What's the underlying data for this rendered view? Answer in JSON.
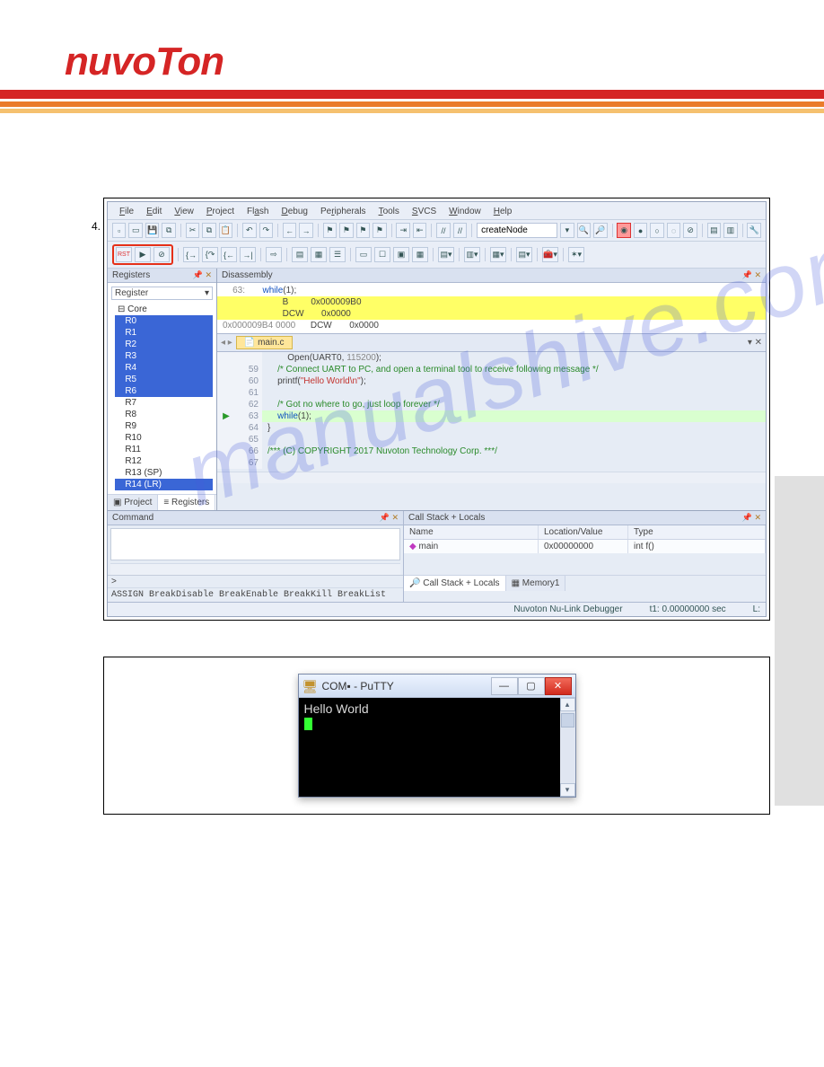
{
  "header": {
    "logo": "nuvoTon"
  },
  "document": {
    "step_label": "4."
  },
  "watermark": "manualshive.com",
  "ide": {
    "menu": [
      "File",
      "Edit",
      "View",
      "Project",
      "Flash",
      "Debug",
      "Peripherals",
      "Tools",
      "SVCS",
      "Window",
      "Help"
    ],
    "combo_value": "createNode",
    "panes": {
      "registers": {
        "title": "Registers",
        "dropdown": "Register",
        "tree_root": "Core",
        "regs": [
          "R0",
          "R1",
          "R2",
          "R3",
          "R4",
          "R5",
          "R6",
          "R7",
          "R8",
          "R9",
          "R10",
          "R11",
          "R12",
          "R13 (SP)",
          "R14 (LR)"
        ],
        "selected": [
          "R0",
          "R1",
          "R2",
          "R3",
          "R4",
          "R5",
          "R6",
          "R14 (LR)"
        ],
        "tabs": [
          "Project",
          "Registers"
        ],
        "active_tab": "Registers"
      },
      "disassembly": {
        "title": "Disassembly",
        "lines": [
          {
            "n": "63:",
            "txt": "while(1);",
            "hl": false
          },
          {
            "n": "",
            "txt": "B         0x000009B0",
            "hl": true
          },
          {
            "n": "",
            "txt": "DCW       0x0000",
            "hl": true
          },
          {
            "n": "0x000009B4 0000",
            "txt": "DCW       0x0000",
            "hl": false
          }
        ]
      },
      "source": {
        "tab": "main.c",
        "lines": [
          {
            "n": "",
            "g": "",
            "txt": "    Open(UART0, 115200);",
            "cls": ""
          },
          {
            "n": "",
            "g": "",
            "txt": "",
            "cls": ""
          },
          {
            "n": "59",
            "g": "",
            "txt": "    /* Connect UART to PC, and open a terminal tool to receive following message */",
            "cls": "c-comment"
          },
          {
            "n": "60",
            "g": "",
            "txt": "    printf(\"Hello World\\n\");",
            "cls": ""
          },
          {
            "n": "61",
            "g": "",
            "txt": "",
            "cls": ""
          },
          {
            "n": "62",
            "g": "",
            "txt": "    /* Got no where to go, just loop forever */",
            "cls": "c-comment"
          },
          {
            "n": "63",
            "g": "▶",
            "txt": "    while(1);",
            "cls": "src-hl c-kw"
          },
          {
            "n": "64",
            "g": "",
            "txt": "}",
            "cls": ""
          },
          {
            "n": "65",
            "g": "",
            "txt": "",
            "cls": ""
          },
          {
            "n": "66",
            "g": "",
            "txt": "/*** (C) COPYRIGHT 2017 Nuvoton Technology Corp. ***/",
            "cls": "c-comment"
          },
          {
            "n": "67",
            "g": "",
            "txt": "",
            "cls": ""
          }
        ]
      },
      "command": {
        "title": "Command",
        "prompt": ">",
        "hints": "ASSIGN BreakDisable BreakEnable BreakKill BreakList"
      },
      "callstack": {
        "title": "Call Stack + Locals",
        "cols": [
          "Name",
          "Location/Value",
          "Type"
        ],
        "row": {
          "name": "main",
          "loc": "0x00000000",
          "type": "int f()"
        },
        "tabs": [
          "Call Stack + Locals",
          "Memory1"
        ]
      }
    },
    "status": {
      "debugger": "Nuvoton Nu-Link Debugger",
      "time": "t1: 0.00000000 sec",
      "extra": "L:"
    }
  },
  "putty": {
    "title_prefix": "COM",
    "title_suffix": " - PuTTY",
    "output": "Hello World"
  }
}
